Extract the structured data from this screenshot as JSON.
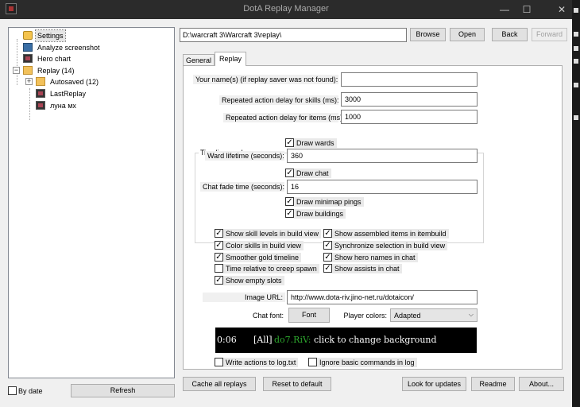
{
  "window": {
    "title": "DotA Replay Manager"
  },
  "titlebar": {
    "min_glyph": "—",
    "max_glyph": "☐",
    "close_glyph": "✕"
  },
  "tree": {
    "items": [
      {
        "label": "Settings",
        "icon": "settings-icon"
      },
      {
        "label": "Analyze screenshot",
        "icon": "screenshot-icon"
      },
      {
        "label": "Hero chart",
        "icon": "hero-chart-icon"
      },
      {
        "label": "Replay (14)",
        "icon": "folder-icon"
      },
      {
        "label": "Autosaved (12)",
        "icon": "folder-icon"
      },
      {
        "label": "LastReplay",
        "icon": "replay-file-icon"
      },
      {
        "label": "луна мх",
        "icon": "replay-file-icon"
      }
    ],
    "expanders": {
      "replay": "−",
      "autosaved": "+"
    }
  },
  "bottom_left": {
    "by_date_label": "By date",
    "by_date_checked": false,
    "refresh_label": "Refresh"
  },
  "pathbar": {
    "path": "D:\\warcraft 3\\Warcraft 3\\replay\\",
    "browse": "Browse",
    "open": "Open",
    "back": "Back",
    "forward": "Forward"
  },
  "tabs": [
    {
      "label": "General",
      "active": false
    },
    {
      "label": "Replay",
      "active": true
    }
  ],
  "replay_tab": {
    "your_names": {
      "label": "Your name(s) (if replay saver was not found):",
      "value": ""
    },
    "skill_delay": {
      "label": "Repeated action delay for skills (ms):",
      "value": "3000"
    },
    "item_delay": {
      "label": "Repeated action delay for items (ms):",
      "value": "1000"
    },
    "timeline": {
      "title": "Timeline mode",
      "draw_wards": {
        "label": "Draw wards",
        "checked": true
      },
      "ward_lifetime": {
        "label": "Ward lifetime (seconds):",
        "value": "360"
      },
      "draw_chat": {
        "label": "Draw chat",
        "checked": true
      },
      "chat_fade": {
        "label": "Chat fade time (seconds):",
        "value": "16"
      },
      "draw_pings": {
        "label": "Draw minimap pings",
        "checked": true
      },
      "draw_buildings": {
        "label": "Draw buildings",
        "checked": true
      }
    },
    "options_left": [
      {
        "label": "Show skill levels in build view",
        "checked": true
      },
      {
        "label": "Color skills in build view",
        "checked": true
      },
      {
        "label": "Smoother gold timeline",
        "checked": true
      },
      {
        "label": "Time relative to creep spawn",
        "checked": false
      },
      {
        "label": "Show empty slots",
        "checked": true
      }
    ],
    "options_right": [
      {
        "label": "Show assembled items in itembuild",
        "checked": true
      },
      {
        "label": "Synchronize selection in build view",
        "checked": true
      },
      {
        "label": "Show hero names in chat",
        "checked": true
      },
      {
        "label": "Show assists in chat",
        "checked": true
      }
    ],
    "image_url": {
      "label": "Image URL:",
      "value": "http://www.dota-riv.jino-net.ru/dotaicon/"
    },
    "chat_font": {
      "label": "Chat font:",
      "button": "Font"
    },
    "player_colors": {
      "label": "Player colors:",
      "value": "Adapted",
      "chevron": "⌵"
    },
    "chat_preview": {
      "time": "0:06",
      "channel": "[All]",
      "player": "do7.RiV:",
      "message": "click to change background",
      "colors": {
        "background": "#000000",
        "text": "#ffffff",
        "player": "#2ea82e"
      }
    },
    "write_log": {
      "label": "Write actions to log.txt",
      "checked": false
    },
    "ignore_basic": {
      "label": "Ignore basic commands in log",
      "checked": false
    }
  },
  "footer": {
    "cache_all": "Cache all replays",
    "reset_default": "Reset to default",
    "look_updates": "Look for updates",
    "readme": "Readme",
    "about": "About..."
  },
  "colors": {
    "titlebar": "#2b2b2b",
    "window": "#f0f0f0",
    "panel": "#ffffff",
    "border": "#adadad"
  }
}
